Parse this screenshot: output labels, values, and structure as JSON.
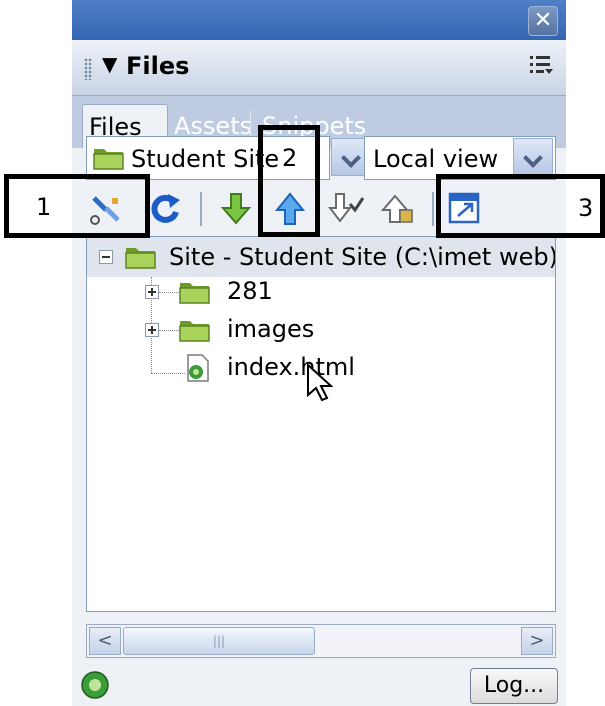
{
  "panel": {
    "close_symbol": "✕",
    "title": "Files",
    "collapse_arrow": "▼",
    "options_icon": "panel-options-menu-icon"
  },
  "tabs": [
    "Files",
    "Assets",
    "Snippets"
  ],
  "site_select": {
    "value": "Student Site"
  },
  "view_select": {
    "value": "Local view"
  },
  "toolbar": {
    "icons": [
      "connect-remote-icon",
      "refresh-icon",
      "get-files-icon",
      "put-files-icon",
      "check-out-icon",
      "check-in-icon",
      "expand-site-icon"
    ]
  },
  "tree": {
    "root": "Site - Student Site (C:\\imet web)",
    "items": [
      "281",
      "images",
      "index.html"
    ]
  },
  "scrollbar": {
    "left": "<",
    "right": ">",
    "thumb": "|||"
  },
  "status": {
    "log_label": "Log..."
  },
  "callouts": {
    "one": "1",
    "two": "2",
    "three": "3"
  },
  "colors": {
    "titlebar": "#3e6fbd",
    "panel": "#c9d4e6",
    "folder": "#8fbf3f",
    "accent_arrow": "#1e88e5"
  }
}
